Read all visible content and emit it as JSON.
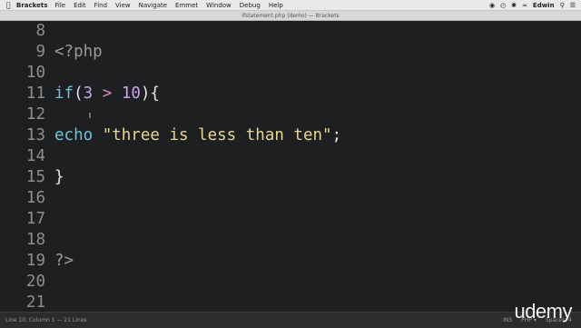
{
  "menubar": {
    "apple": "",
    "app": "Brackets",
    "items": [
      "File",
      "Edit",
      "Find",
      "View",
      "Navigate",
      "Emmet",
      "Window",
      "Debug",
      "Help"
    ],
    "user": "Edwin"
  },
  "window": {
    "title": "ifstatement.php (demo) — Brackets"
  },
  "editor": {
    "lines": [
      {
        "num": "8",
        "tokens": []
      },
      {
        "num": "9",
        "tokens": [
          {
            "t": "php",
            "v": "<?php"
          }
        ]
      },
      {
        "num": "10",
        "tokens": []
      },
      {
        "num": "11",
        "tokens": [
          {
            "t": "kw",
            "v": "if"
          },
          {
            "t": "pun",
            "v": "("
          },
          {
            "t": "num",
            "v": "3"
          },
          {
            "t": "pun",
            "v": " "
          },
          {
            "t": "op",
            "v": ">"
          },
          {
            "t": "pun",
            "v": " "
          },
          {
            "t": "num",
            "v": "10"
          },
          {
            "t": "pun",
            "v": "){"
          }
        ]
      },
      {
        "num": "12",
        "tokens": []
      },
      {
        "num": "13",
        "tokens": [
          {
            "t": "kw",
            "v": "echo"
          },
          {
            "t": "pun",
            "v": " "
          },
          {
            "t": "str",
            "v": "\"three is less than ten\""
          },
          {
            "t": "pun",
            "v": ";"
          }
        ]
      },
      {
        "num": "14",
        "tokens": []
      },
      {
        "num": "15",
        "tokens": [
          {
            "t": "pun",
            "v": "}"
          }
        ]
      },
      {
        "num": "16",
        "tokens": []
      },
      {
        "num": "17",
        "tokens": []
      },
      {
        "num": "18",
        "tokens": []
      },
      {
        "num": "19",
        "tokens": [
          {
            "t": "php",
            "v": "?>"
          }
        ]
      },
      {
        "num": "20",
        "tokens": []
      },
      {
        "num": "21",
        "tokens": []
      }
    ]
  },
  "statusbar": {
    "position": "Line 10, Column 1 — 21 Lines",
    "ins": "INS",
    "language": "PHP ▾",
    "spaces": "Spaces: 4"
  },
  "watermark": "udemy"
}
